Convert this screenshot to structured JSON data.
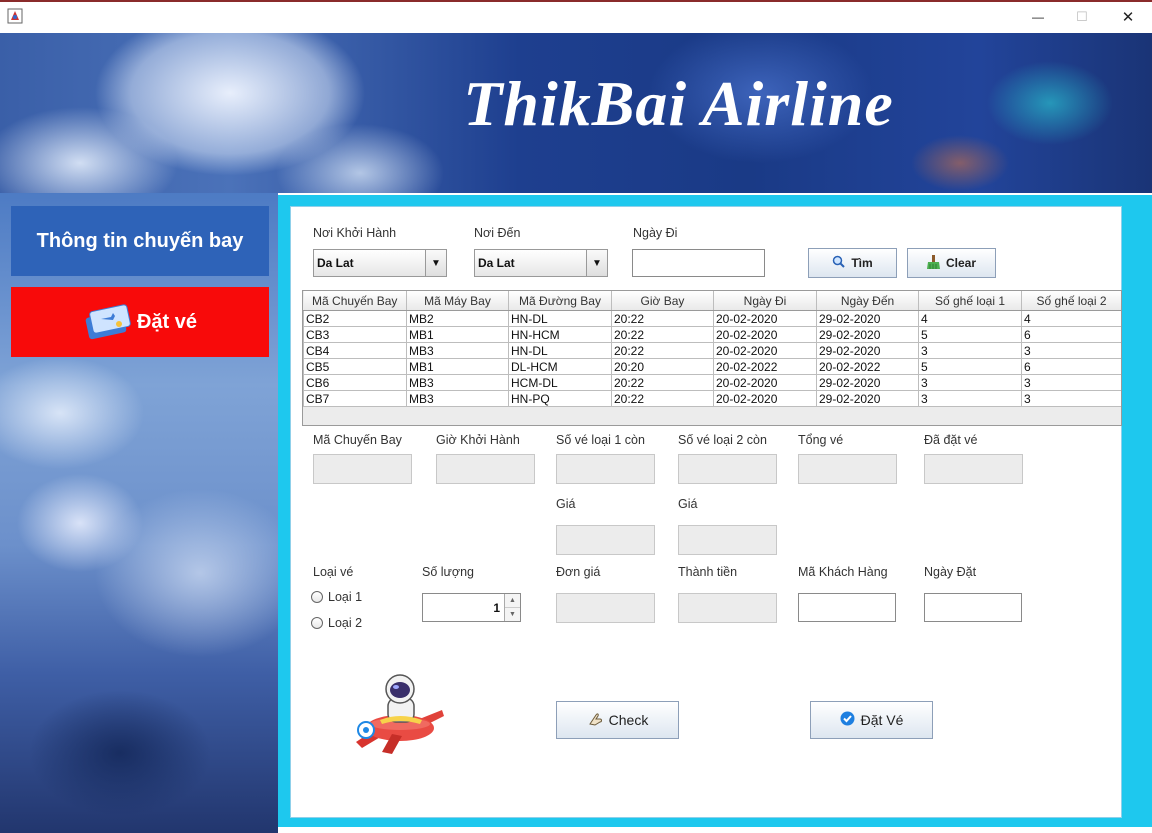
{
  "window": {
    "minimize": "—",
    "maximize": "☐",
    "close": "✕"
  },
  "banner": {
    "title": "ThikBai Airline"
  },
  "sidebar": {
    "info_label": "Thông tin chuyến bay",
    "book_label": "Đặt vé",
    "book_icon": "ticket-icon"
  },
  "search": {
    "from_label": "Nơi Khởi Hành",
    "from_value": "Da Lat",
    "to_label": "Nơi Đến",
    "to_value": "Da Lat",
    "date_label": "Ngày Đi",
    "date_value": "",
    "find_label": "Tìm",
    "clear_label": "Clear"
  },
  "table": {
    "columns": [
      "Mã Chuyến Bay",
      "Mã Máy Bay",
      "Mã Đường Bay",
      "Giờ Bay",
      "Ngày Đi",
      "Ngày Đến",
      "Số ghế loại 1",
      "Số ghế loại 2"
    ],
    "rows": [
      [
        "CB2",
        "MB2",
        "HN-DL",
        "20:22",
        "20-02-2020",
        "29-02-2020",
        "4",
        "4"
      ],
      [
        "CB3",
        "MB1",
        "HN-HCM",
        "20:22",
        "20-02-2020",
        "29-02-2020",
        "5",
        "6"
      ],
      [
        "CB4",
        "MB3",
        "HN-DL",
        "20:22",
        "20-02-2020",
        "29-02-2020",
        "3",
        "3"
      ],
      [
        "CB5",
        "MB1",
        "DL-HCM",
        "20:20",
        "20-02-2022",
        "20-02-2022",
        "5",
        "6"
      ],
      [
        "CB6",
        "MB3",
        "HCM-DL",
        "20:22",
        "20-02-2020",
        "29-02-2020",
        "3",
        "3"
      ],
      [
        "CB7",
        "MB3",
        "HN-PQ",
        "20:22",
        "20-02-2020",
        "29-02-2020",
        "3",
        "3"
      ]
    ]
  },
  "details": {
    "flight_code_label": "Mã Chuyến Bay",
    "depart_time_label": "Giờ Khởi Hành",
    "type1_left_label": "Số vé loại 1 còn",
    "type2_left_label": "Số vé loại 2 còn",
    "total_label": "Tổng vé",
    "booked_label": "Đã đặt vé",
    "price1_label": "Giá",
    "price2_label": "Giá"
  },
  "booking": {
    "ticket_type_label": "Loại vé",
    "type1_option": "Loại 1",
    "type2_option": "Loại 2",
    "quantity_label": "Số lượng",
    "quantity_value": "1",
    "unit_price_label": "Đơn giá",
    "subtotal_label": "Thành tiền",
    "customer_label": "Mã Khách Hàng",
    "book_date_label": "Ngày Đặt",
    "check_label": "Check",
    "book_label": "Đặt Vé"
  },
  "colors": {
    "sidebar_info": "#2e63b8",
    "sidebar_book": "#f80a0a",
    "panel_border": "#1ec8ee"
  }
}
